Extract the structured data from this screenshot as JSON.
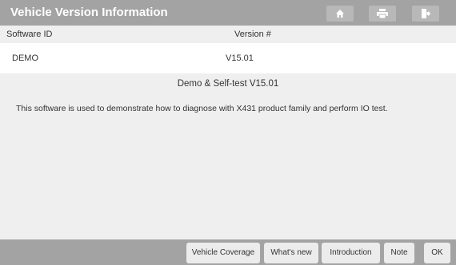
{
  "window": {
    "title": "Vehicle Version Information"
  },
  "toolbar": {
    "home_icon": "home-icon",
    "print_icon": "print-icon",
    "exit_icon": "exit-icon"
  },
  "table": {
    "headers": {
      "software_id": "Software ID",
      "version": "Version #"
    },
    "row": {
      "software_id": "DEMO",
      "version": "V15.01"
    }
  },
  "content": {
    "title": "Demo & Self-test V15.01",
    "description": "This software is used to demonstrate how to diagnose with X431 product family and perform IO test."
  },
  "footer": {
    "buttons": [
      "Vehicle Coverage",
      "What's new",
      "Introduction",
      "Note",
      "OK"
    ]
  },
  "colors": {
    "title_bar": "#a3a3a3",
    "header_bg": "#efefef",
    "content_bg": "#efefef",
    "button_bg": "#ececec"
  }
}
